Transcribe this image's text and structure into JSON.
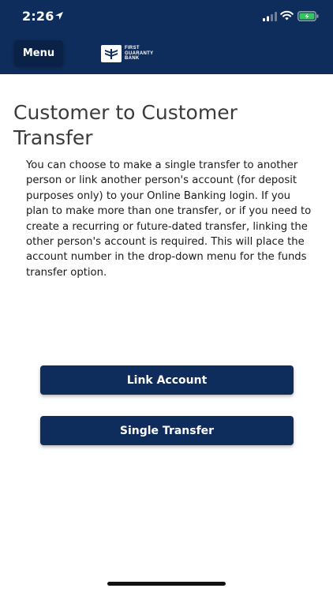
{
  "status_bar": {
    "time": "2:26"
  },
  "header": {
    "menu_label": "Menu",
    "logo_lines": [
      "FIRST",
      "GUARANTY",
      "BANK"
    ]
  },
  "page": {
    "title": "Customer to Customer Transfer",
    "description": "You can choose to make a single transfer to another person or link another person's account (for deposit purposes only) to your Online Banking login. If you plan to make more than one transfer, or if you need to create a recurring or future-dated transfer, linking the other person's account is required. This will place the account number in the drop-down menu for the funds transfer option."
  },
  "actions": {
    "link_account_label": "Link Account",
    "single_transfer_label": "Single Transfer"
  },
  "colors": {
    "brand_navy": "#0f2d5c",
    "battery_green": "#34c759"
  }
}
